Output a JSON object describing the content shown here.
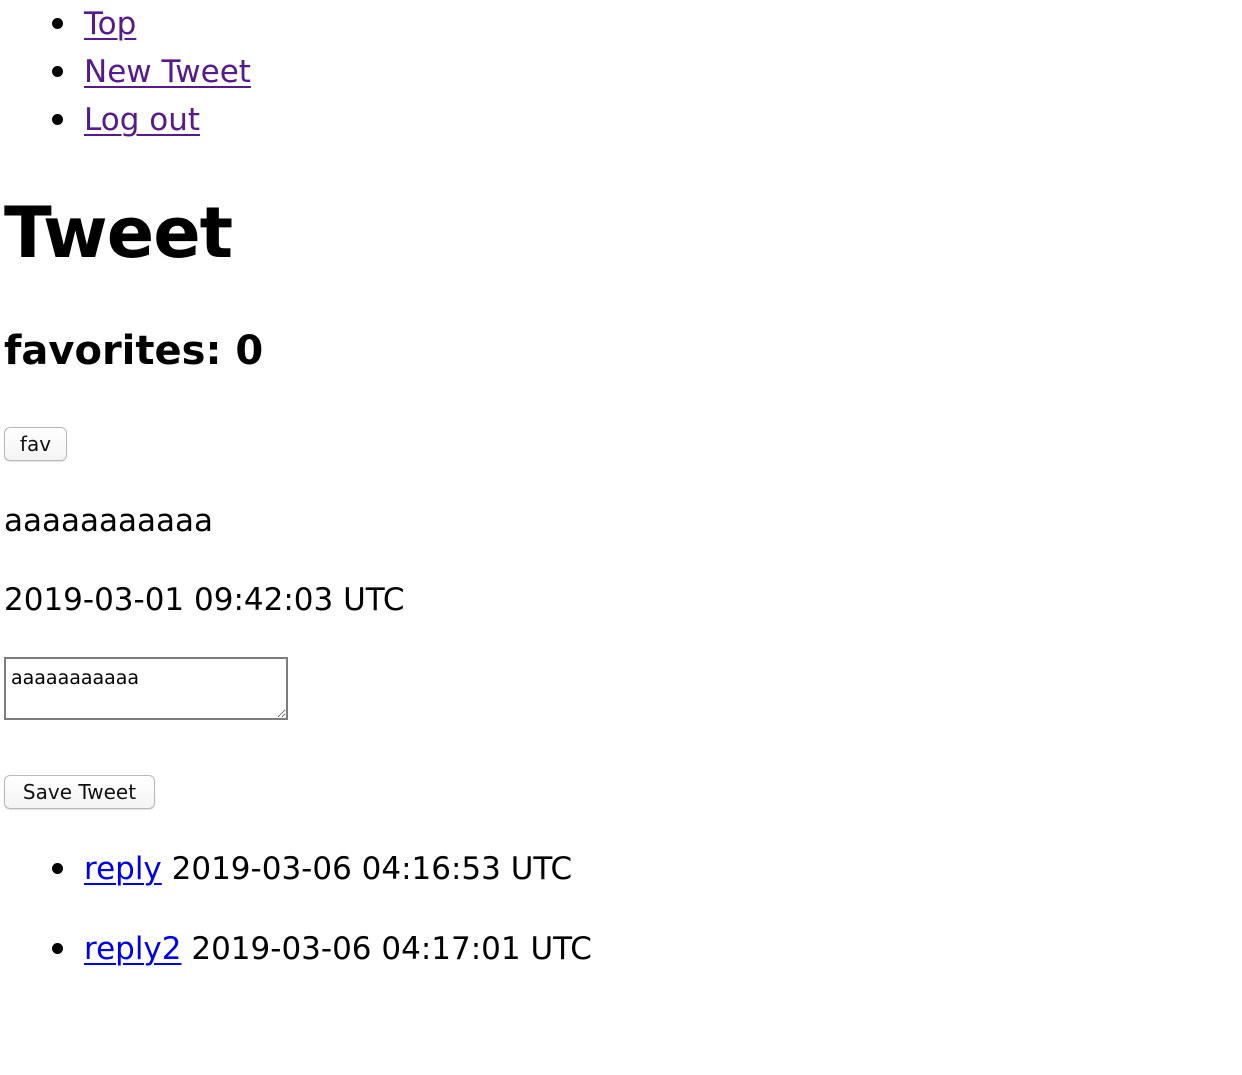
{
  "nav": {
    "items": [
      {
        "label": "Top"
      },
      {
        "label": "New Tweet"
      },
      {
        "label": "Log out"
      }
    ]
  },
  "tweet": {
    "title": "Tweet",
    "favorites_label": "favorites: 0",
    "fav_button": "fav",
    "content": "aaaaaaaaaaa",
    "created_at": "2019-03-01 09:42:03 UTC",
    "textarea_value": "aaaaaaaaaaa",
    "save_button": "Save Tweet"
  },
  "replies": [
    {
      "label": "reply",
      "created_at": "2019-03-06 04:16:53 UTC"
    },
    {
      "label": "reply2",
      "created_at": "2019-03-06 04:17:01 UTC"
    }
  ],
  "colors": {
    "visited_link": "#551a8b",
    "link": "#0000ee"
  }
}
